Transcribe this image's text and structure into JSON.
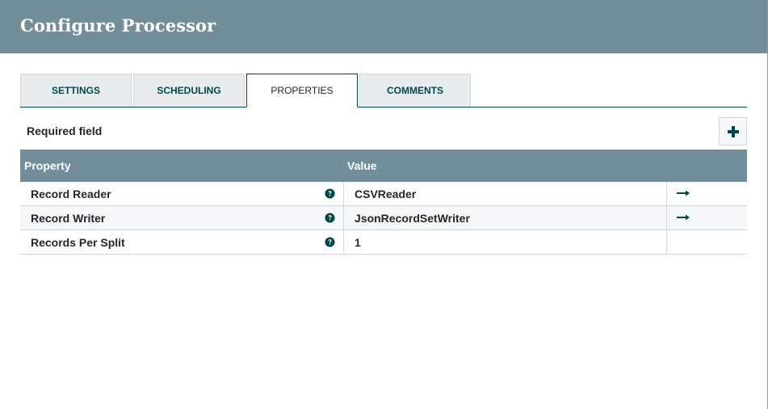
{
  "dialog": {
    "title": "Configure Processor"
  },
  "tabs": [
    {
      "label": "SETTINGS",
      "active": false
    },
    {
      "label": "SCHEDULING",
      "active": false
    },
    {
      "label": "PROPERTIES",
      "active": true
    },
    {
      "label": "COMMENTS",
      "active": false
    }
  ],
  "properties": {
    "required_label": "Required field",
    "add_button_icon": "plus-icon",
    "columns": {
      "property": "Property",
      "value": "Value"
    },
    "rows": [
      {
        "name": "Record Reader",
        "value": "CSVReader",
        "help_icon": "question-circle-icon",
        "has_goto": true,
        "goto_icon": "arrow-right-icon"
      },
      {
        "name": "Record Writer",
        "value": "JsonRecordSetWriter",
        "help_icon": "question-circle-icon",
        "has_goto": true,
        "goto_icon": "arrow-right-icon"
      },
      {
        "name": "Records Per Split",
        "value": "1",
        "help_icon": "question-circle-icon",
        "has_goto": false
      }
    ]
  },
  "colors": {
    "header_bg": "#728e9b",
    "accent": "#004849",
    "tab_bg": "#e8ecef",
    "border": "#cfd8dc"
  }
}
